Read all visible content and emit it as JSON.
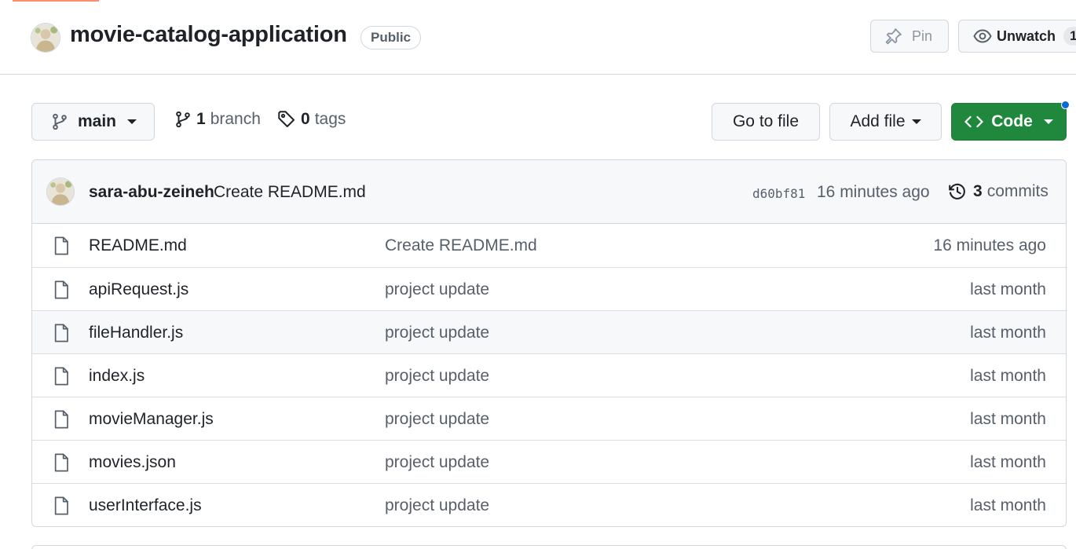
{
  "repo": {
    "name": "movie-catalog-application",
    "visibility": "Public"
  },
  "header_actions": {
    "pin_label": "Pin",
    "watch_label": "Unwatch",
    "watch_count": "1"
  },
  "toolbar": {
    "branch_name": "main",
    "branch_count": "1",
    "branch_label": "branch",
    "tag_count": "0",
    "tag_label": "tags",
    "go_to_file_label": "Go to file",
    "add_file_label": "Add file",
    "code_label": "Code"
  },
  "latest_commit": {
    "author": "sara-abu-zeineh",
    "message": "Create README.md",
    "sha": "d60bf81",
    "time": "16 minutes ago",
    "commit_count": "3",
    "commits_label": "commits"
  },
  "files": [
    {
      "name": "README.md",
      "commit": "Create README.md",
      "age": "16 minutes ago"
    },
    {
      "name": "apiRequest.js",
      "commit": "project update",
      "age": "last month"
    },
    {
      "name": "fileHandler.js",
      "commit": "project update",
      "age": "last month"
    },
    {
      "name": "index.js",
      "commit": "project update",
      "age": "last month"
    },
    {
      "name": "movieManager.js",
      "commit": "project update",
      "age": "last month"
    },
    {
      "name": "movies.json",
      "commit": "project update",
      "age": "last month"
    },
    {
      "name": "userInterface.js",
      "commit": "project update",
      "age": "last month"
    }
  ],
  "icons": {
    "pin": "pin-icon",
    "watch": "eye-icon",
    "branch": "git-branch-icon",
    "tag": "tag-icon",
    "code": "code-icon",
    "history": "history-icon",
    "file": "file-icon"
  },
  "colors": {
    "primary_button": "#1f883d",
    "notification_dot": "#0969da",
    "underline_accent": "#fd8c73"
  }
}
